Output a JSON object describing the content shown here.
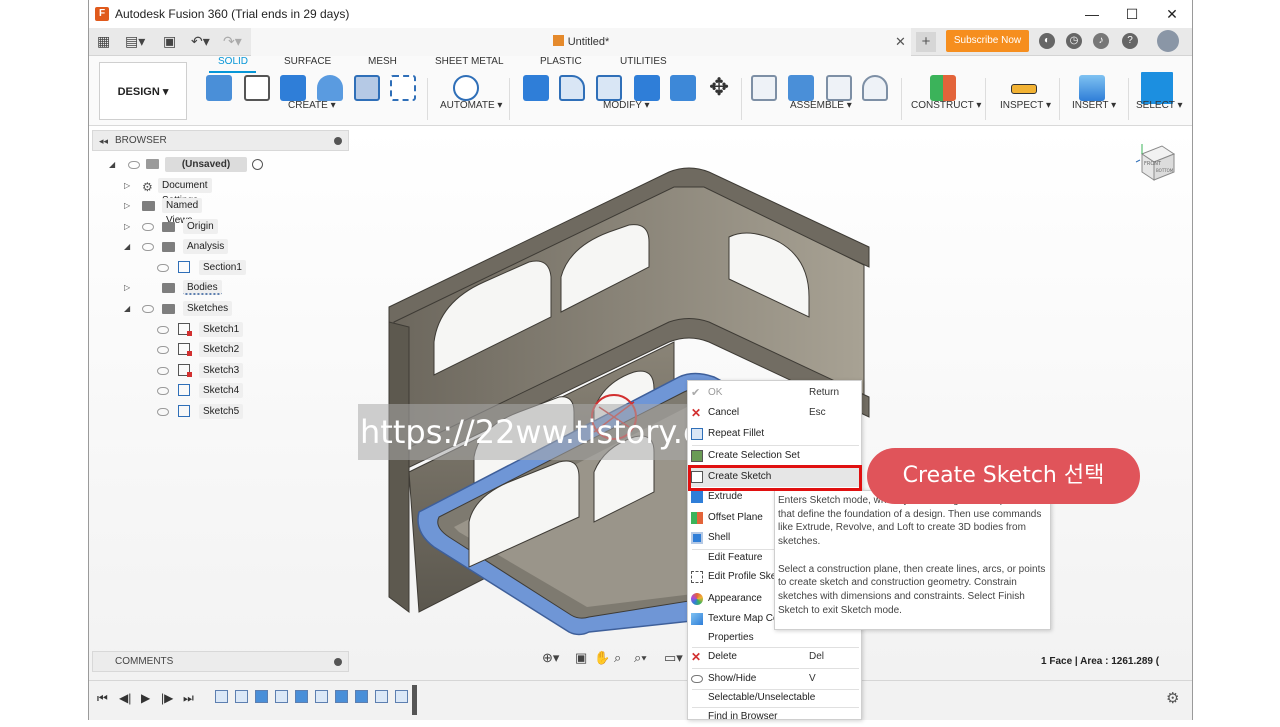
{
  "window": {
    "title": "Autodesk Fusion 360 (Trial ends in 29 days)",
    "minimize": "—",
    "maximize": "☐",
    "close": "✕"
  },
  "tabbar": {
    "doc_title": "Untitled*",
    "close_tab": "✕",
    "new_tab": "+",
    "subscribe": "Subscribe Now"
  },
  "ribbon": {
    "design_label": "DESIGN ▾",
    "tabs": [
      "SOLID",
      "SURFACE",
      "MESH",
      "SHEET METAL",
      "PLASTIC",
      "UTILITIES"
    ],
    "active_tab": "SOLID",
    "groups": {
      "create": "CREATE ▾",
      "automate": "AUTOMATE ▾",
      "modify": "MODIFY ▾",
      "assemble": "ASSEMBLE ▾",
      "construct": "CONSTRUCT ▾",
      "inspect": "INSPECT ▾",
      "insert": "INSERT ▾",
      "select": "SELECT ▾"
    }
  },
  "browser": {
    "title": "BROWSER",
    "root": "(Unsaved)",
    "items": {
      "document_settings": "Document Settings",
      "named_views": "Named Views",
      "origin": "Origin",
      "analysis": "Analysis",
      "section1": "Section1",
      "bodies": "Bodies",
      "sketches": "Sketches",
      "sketch1": "Sketch1",
      "sketch2": "Sketch2",
      "sketch3": "Sketch3",
      "sketch4": "Sketch4",
      "sketch5": "Sketch5"
    }
  },
  "comments": {
    "title": "COMMENTS"
  },
  "status": {
    "selection": "1 Face | Area : 1261.289 ("
  },
  "watermark": "https://22ww.tistory.com",
  "context_menu": {
    "ok": "OK",
    "ok_shortcut": "Return",
    "cancel": "Cancel",
    "cancel_shortcut": "Esc",
    "repeat": "Repeat Fillet",
    "create_selection_set": "Create Selection Set",
    "create_sketch": "Create Sketch",
    "extrude": "Extrude",
    "offset_plane": "Offset Plane",
    "shell": "Shell",
    "edit_feature": "Edit Feature",
    "edit_profile_sketch": "Edit Profile Ske",
    "appearance": "Appearance",
    "texture_map": "Texture Map Co",
    "properties": "Properties",
    "delete": "Delete",
    "delete_shortcut": "Del",
    "show_hide": "Show/Hide",
    "show_hide_shortcut": "V",
    "selectable": "Selectable/Unselectable",
    "find_in_browser": "Find in Browser"
  },
  "tooltip": {
    "para1": "Enters Sketch mode, where you create geometric profiles that define the foundation of a design. Then use commands like Extrude, Revolve, and Loft to create 3D bodies from sketches.",
    "para2": "Select a construction plane, then create lines, arcs, or points to create sketch and construction geometry. Constrain sketches with dimensions and constraints. Select Finish Sketch to exit Sketch mode."
  },
  "callout": "Create Sketch 선택",
  "viewcube": {
    "front": "FRONT",
    "bottom": "BOTTOM"
  },
  "colors": {
    "accent": "#0696d7",
    "subscribe": "#f68e1e",
    "highlight": "#e01010",
    "callout": "#e0545a",
    "face_select": "#6f96d6"
  }
}
